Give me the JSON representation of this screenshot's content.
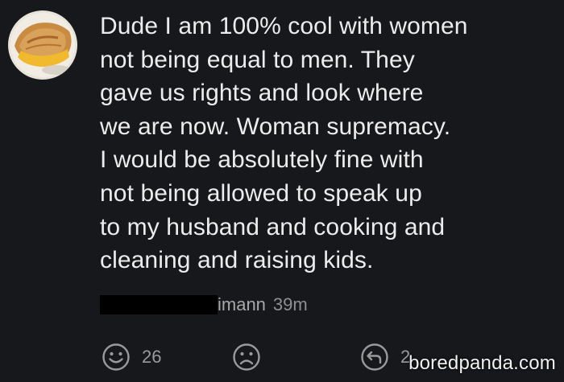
{
  "comment": {
    "lines": [
      "Dude I am 100% cool with women",
      "not being equal to men. They",
      "gave us rights and look where",
      "we are now. Woman supremacy.",
      "I would be absolutely fine with",
      "not being allowed to speak up",
      "to my husband and cooking and",
      "cleaning and raising kids."
    ],
    "author_suffix": "imann",
    "timestamp": "39m"
  },
  "actions": {
    "like_count": "26",
    "reply_count": "2"
  },
  "watermark": "boredpanda.com",
  "colors": {
    "background": "#17181c",
    "text": "#ececec",
    "muted": "#9a9a9a",
    "redaction": "#000000"
  }
}
